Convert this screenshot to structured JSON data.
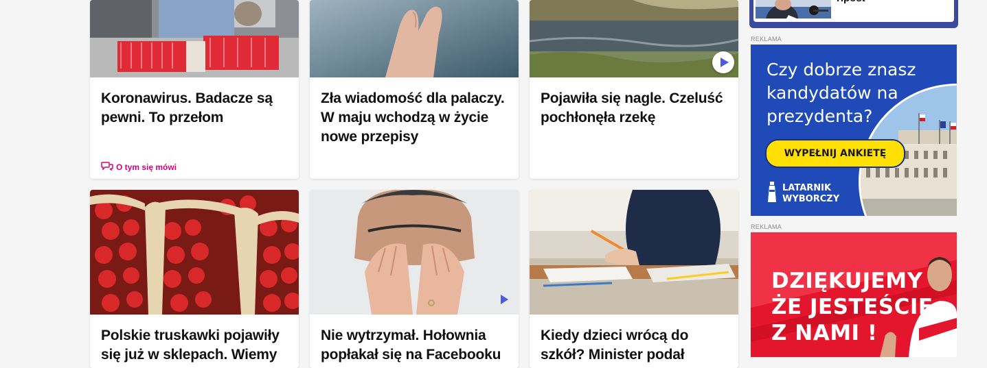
{
  "articles": [
    {
      "title": "Koronawirus. Badacze są pewni. To przełom",
      "tag": "O tym się mówi"
    },
    {
      "title": "Zła wiadomość dla palaczy. W maju wchodzą w życie nowe przepisy"
    },
    {
      "title": "Pojawiła się nagle. Czeluść pochłonęła rzekę"
    },
    {
      "title": "Polskie truskawki pojawiły się już w sklepach. Wiemy"
    },
    {
      "title": "Nie wytrzymał. Hołownia popłakał się na Facebooku"
    },
    {
      "title": "Kiedy dzieci wrócą do szkół? Minister podał"
    }
  ],
  "sidebar": {
    "teaser_text": "ripost"
  },
  "ads": [
    {
      "label": "REKLAMA",
      "headline": [
        "Czy dobrze znasz",
        "kandydatów na",
        "prezydenta?"
      ],
      "button": "WYPEŁNIJ ANKIETĘ",
      "brand": [
        "LATARNIK",
        "WYBORCZY"
      ]
    },
    {
      "label": "REKLAMA",
      "headline": [
        "DZIĘKUJEMY",
        "ŻE JESTEŚCIE",
        "Z NAMI !"
      ]
    }
  ],
  "colors": {
    "background": "#f5f5f5",
    "accent_pink": "#d6007a",
    "play_blue": "#4b5bdc",
    "ad1_blue": "#1f4ab8",
    "ad1_yellow": "#ffe000",
    "ad2_red": "#e3162e",
    "sidebox_border": "#3a4aa0"
  }
}
